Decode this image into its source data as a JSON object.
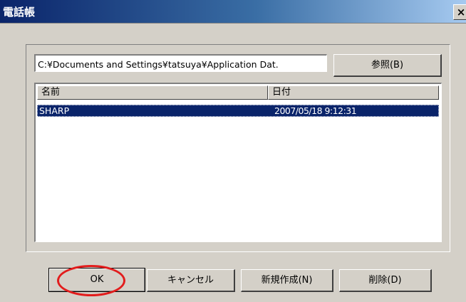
{
  "window": {
    "title": "電話帳",
    "close_label": "×"
  },
  "path": {
    "value": "C:¥Documents and Settings¥tatsuya¥Application Dat."
  },
  "buttons": {
    "browse": "参照(B)",
    "ok": "OK",
    "cancel": "キャンセル",
    "new": "新規作成(N)",
    "delete": "削除(D)"
  },
  "list": {
    "columns": [
      "名前",
      "日付"
    ],
    "rows": [
      {
        "name": "SHARP",
        "date": "2007/05/18 9:12:31",
        "selected": true
      }
    ]
  },
  "colors": {
    "selection": "#0a246a",
    "dialog_face": "#d4d0c8",
    "annotation": "#e21c1c"
  }
}
